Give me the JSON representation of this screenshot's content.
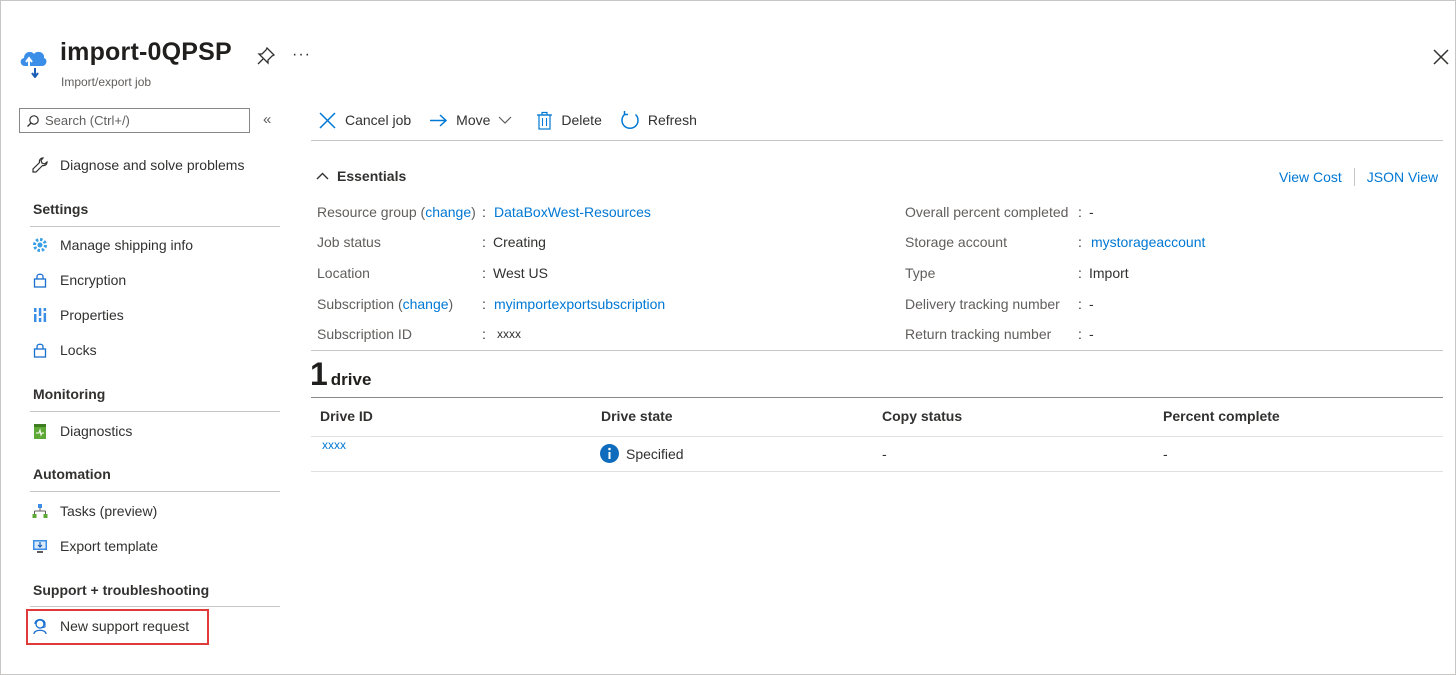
{
  "header": {
    "title": "import-0QPSP",
    "subtitle": "Import/export job",
    "more": "···"
  },
  "search": {
    "placeholder": "Search (Ctrl+/)"
  },
  "sidebar": {
    "collapse": "«",
    "diagnose": "Diagnose and solve problems",
    "sections": {
      "settings": "Settings",
      "monitoring": "Monitoring",
      "automation": "Automation",
      "support": "Support + troubleshooting"
    },
    "items": {
      "shipping": "Manage shipping info",
      "encryption": "Encryption",
      "properties": "Properties",
      "locks": "Locks",
      "diagnostics": "Diagnostics",
      "tasks": "Tasks (preview)",
      "export": "Export template",
      "support_request": "New support request"
    }
  },
  "toolbar": {
    "cancel": "Cancel job",
    "move": "Move",
    "delete": "Delete",
    "refresh": "Refresh"
  },
  "essentials": {
    "title": "Essentials",
    "view_cost": "View Cost",
    "json_view": "JSON View",
    "colon": ":",
    "change": "change",
    "left": {
      "resource_group": {
        "label": "Resource group",
        "value": "DataBoxWest-Resources"
      },
      "job_status": {
        "label": "Job status",
        "value": "Creating"
      },
      "location": {
        "label": "Location",
        "value": "West US"
      },
      "subscription": {
        "label": "Subscription",
        "value": "myimportexportsubscription"
      },
      "subscription_id": {
        "label": "Subscription ID",
        "value": "xxxx"
      }
    },
    "right": {
      "percent": {
        "label": "Overall percent completed",
        "value": "-"
      },
      "storage": {
        "label": "Storage account",
        "value": "mystorageaccount"
      },
      "type": {
        "label": "Type",
        "value": "Import"
      },
      "delivery": {
        "label": "Delivery tracking number",
        "value": "-"
      },
      "return": {
        "label": "Return tracking number",
        "value": "-"
      }
    }
  },
  "drives": {
    "count": "1",
    "word": "drive",
    "columns": {
      "id": "Drive ID",
      "state": "Drive state",
      "copy": "Copy status",
      "percent": "Percent complete"
    },
    "row": {
      "id": "xxxx",
      "state": "Specified",
      "copy": "-",
      "percent": "-"
    }
  },
  "colors": {
    "accent": "#0078d4",
    "highlight": "#e03a3a",
    "text": "#323130"
  }
}
